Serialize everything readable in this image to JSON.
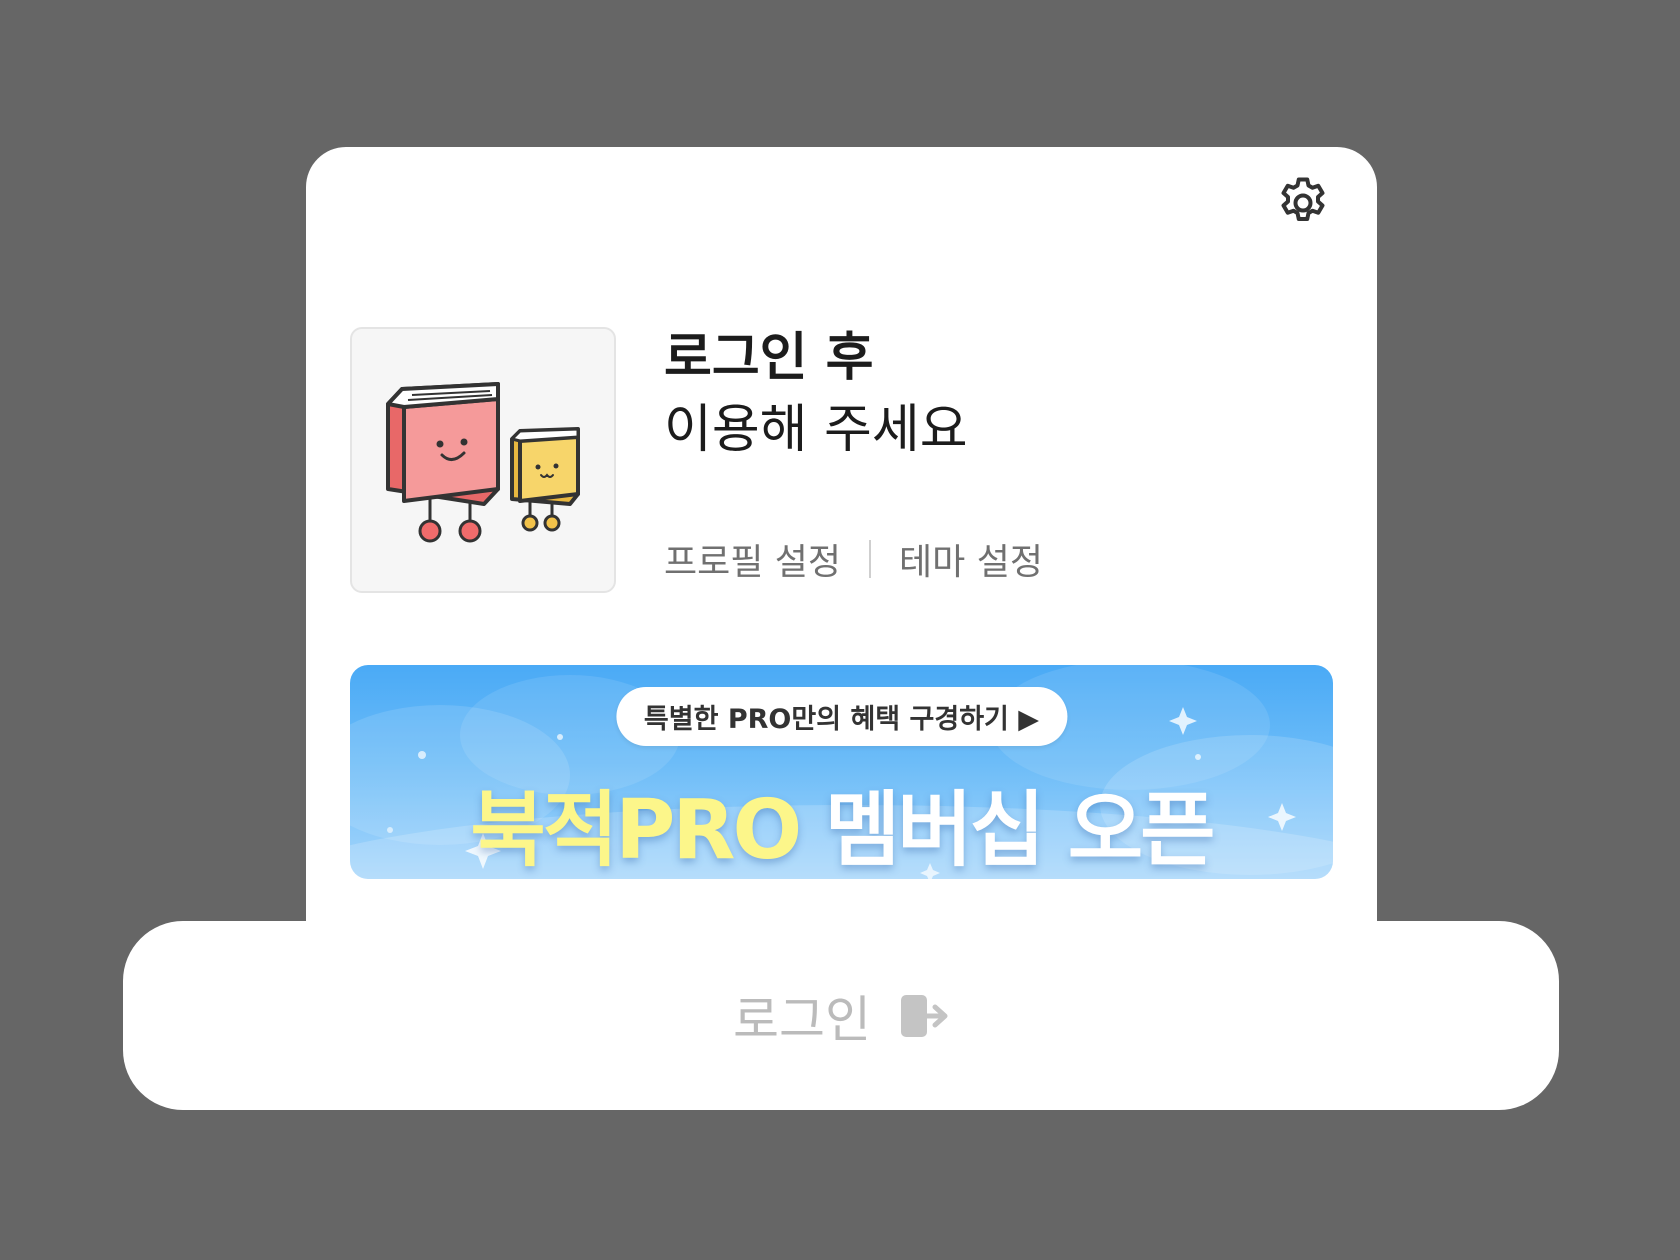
{
  "header": {
    "settings_icon": "gear-icon"
  },
  "profile": {
    "avatar_icon": "book-characters-illustration",
    "message_line1": "로그인 후",
    "message_line2": "이용해 주세요",
    "profile_settings_label": "프로필 설정",
    "theme_settings_label": "테마 설정"
  },
  "banner": {
    "pill_text": "특별한 PRO만의 혜택 구경하기 ▶",
    "title_highlight": "북적PRO",
    "title_rest": "멤버십 오픈",
    "highlight_color": "#fcf68a"
  },
  "footer": {
    "login_label": "로그인",
    "login_icon": "login-arrow-icon"
  }
}
